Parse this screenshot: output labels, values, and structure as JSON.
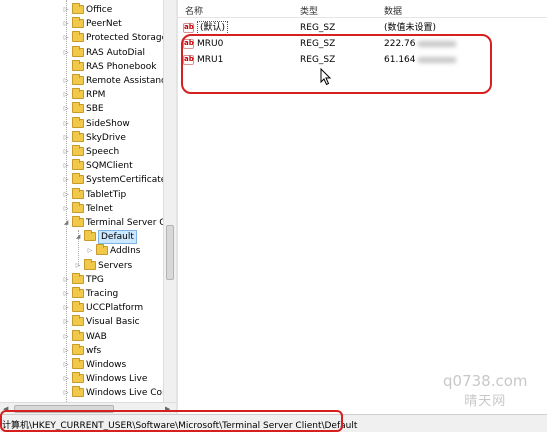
{
  "tree": {
    "items": [
      {
        "label": "Office",
        "level": 0,
        "expander": "▷",
        "selected": false
      },
      {
        "label": "PeerNet",
        "level": 0,
        "expander": "▷",
        "selected": false
      },
      {
        "label": "Protected Storage",
        "level": 0,
        "expander": "▷",
        "selected": false
      },
      {
        "label": "RAS AutoDial",
        "level": 0,
        "expander": "▷",
        "selected": false
      },
      {
        "label": "RAS Phonebook",
        "level": 0,
        "expander": "",
        "selected": false
      },
      {
        "label": "Remote Assistance",
        "level": 0,
        "expander": "▷",
        "selected": false
      },
      {
        "label": "RPM",
        "level": 0,
        "expander": "▷",
        "selected": false
      },
      {
        "label": "SBE",
        "level": 0,
        "expander": "▷",
        "selected": false
      },
      {
        "label": "SideShow",
        "level": 0,
        "expander": "▷",
        "selected": false
      },
      {
        "label": "SkyDrive",
        "level": 0,
        "expander": "▷",
        "selected": false
      },
      {
        "label": "Speech",
        "level": 0,
        "expander": "▷",
        "selected": false
      },
      {
        "label": "SQMClient",
        "level": 0,
        "expander": "▷",
        "selected": false
      },
      {
        "label": "SystemCertificates",
        "level": 0,
        "expander": "▷",
        "selected": false
      },
      {
        "label": "TabletTip",
        "level": 0,
        "expander": "▷",
        "selected": false
      },
      {
        "label": "Telnet",
        "level": 0,
        "expander": "▷",
        "selected": false
      },
      {
        "label": "Terminal Server Cli",
        "level": 0,
        "expander": "◢",
        "selected": false
      },
      {
        "label": "Default",
        "level": 1,
        "expander": "◢",
        "selected": true
      },
      {
        "label": "AddIns",
        "level": 2,
        "expander": "▷",
        "selected": false
      },
      {
        "label": "Servers",
        "level": 1,
        "expander": "▷",
        "selected": false
      },
      {
        "label": "TPG",
        "level": 0,
        "expander": "▷",
        "selected": false
      },
      {
        "label": "Tracing",
        "level": 0,
        "expander": "▷",
        "selected": false
      },
      {
        "label": "UCCPlatform",
        "level": 0,
        "expander": "▷",
        "selected": false
      },
      {
        "label": "Visual Basic",
        "level": 0,
        "expander": "▷",
        "selected": false
      },
      {
        "label": "WAB",
        "level": 0,
        "expander": "▷",
        "selected": false
      },
      {
        "label": "wfs",
        "level": 0,
        "expander": "▷",
        "selected": false
      },
      {
        "label": "Windows",
        "level": 0,
        "expander": "▷",
        "selected": false
      },
      {
        "label": "Windows Live",
        "level": 0,
        "expander": "▷",
        "selected": false
      },
      {
        "label": "Windows Live Cont",
        "level": 0,
        "expander": "▷",
        "selected": false
      }
    ]
  },
  "list": {
    "headers": {
      "name": "名称",
      "type": "类型",
      "data": "数据"
    },
    "rows": [
      {
        "icon": "ab",
        "name": "(默认)",
        "type": "REG_SZ",
        "data": "(数值未设置)",
        "blurred": false,
        "selected": true
      },
      {
        "icon": "ab",
        "name": "MRU0",
        "type": "REG_SZ",
        "data": "222.76",
        "blurred": true,
        "selected": false
      },
      {
        "icon": "ab",
        "name": "MRU1",
        "type": "REG_SZ",
        "data": "61.164",
        "blurred": true,
        "selected": false
      }
    ]
  },
  "statusbar": {
    "path": "计算机\\HKEY_CURRENT_USER\\Software\\Microsoft\\Terminal Server Client\\Default"
  },
  "watermark": {
    "line1": "q0738.com",
    "line2": "晴天网"
  },
  "colors": {
    "highlight": "#d62020",
    "folder": "#f0c84a",
    "selection": "#cce8ff"
  }
}
